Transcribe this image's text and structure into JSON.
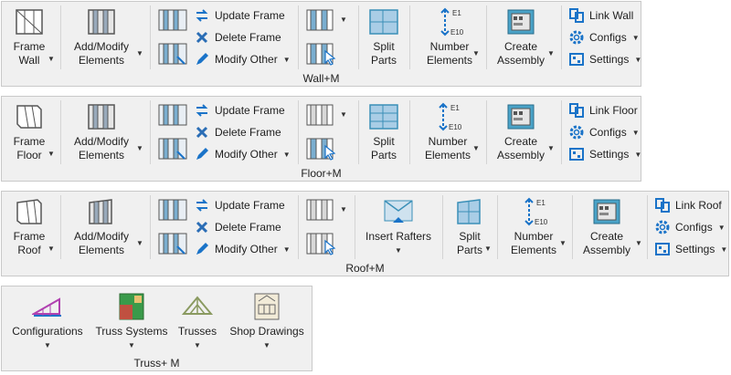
{
  "wall": {
    "title": "Wall+M",
    "frame": [
      "Frame",
      "Wall"
    ],
    "add_modify": [
      "Add/Modify",
      "Elements"
    ],
    "update": "Update Frame",
    "delete": "Delete Frame",
    "modify_other": "Modify Other",
    "split": [
      "Split",
      "Parts"
    ],
    "number": [
      "Number",
      "Elements"
    ],
    "create": [
      "Create",
      "Assembly"
    ],
    "link": "Link Wall",
    "configs": "Configs",
    "settings": "Settings",
    "e_top": "E1",
    "e_bot": "E10"
  },
  "floor": {
    "title": "Floor+M",
    "frame": [
      "Frame",
      "Floor"
    ],
    "add_modify": [
      "Add/Modify",
      "Elements"
    ],
    "update": "Update Frame",
    "delete": "Delete Frame",
    "modify_other": "Modify Other",
    "split": [
      "Split",
      "Parts"
    ],
    "number": [
      "Number",
      "Elements"
    ],
    "create": [
      "Create",
      "Assembly"
    ],
    "link": "Link Floor",
    "configs": "Configs",
    "settings": "Settings",
    "e_top": "E1",
    "e_bot": "E10"
  },
  "roof": {
    "title": "Roof+M",
    "frame": [
      "Frame",
      "Roof"
    ],
    "add_modify": [
      "Add/Modify",
      "Elements"
    ],
    "update": "Update Frame",
    "delete": "Delete Frame",
    "modify_other": "Modify Other",
    "insert_rafters": "Insert Rafters",
    "split": [
      "Split",
      "Parts"
    ],
    "number": [
      "Number",
      "Elements"
    ],
    "create": [
      "Create",
      "Assembly"
    ],
    "link": "Link Roof",
    "configs": "Configs",
    "settings": "Settings",
    "e_top": "E1",
    "e_bot": "E10"
  },
  "truss": {
    "title": "Truss+ M",
    "configurations": "Configurations",
    "truss_systems": "Truss Systems",
    "trusses": "Trusses",
    "shop_drawings": "Shop Drawings"
  },
  "colors": {
    "panel_bg": "#f0f0f0",
    "accent_blue": "#1a73c8",
    "delete_blue": "#2a6db5",
    "teal_icon": "#3a8fb7"
  }
}
